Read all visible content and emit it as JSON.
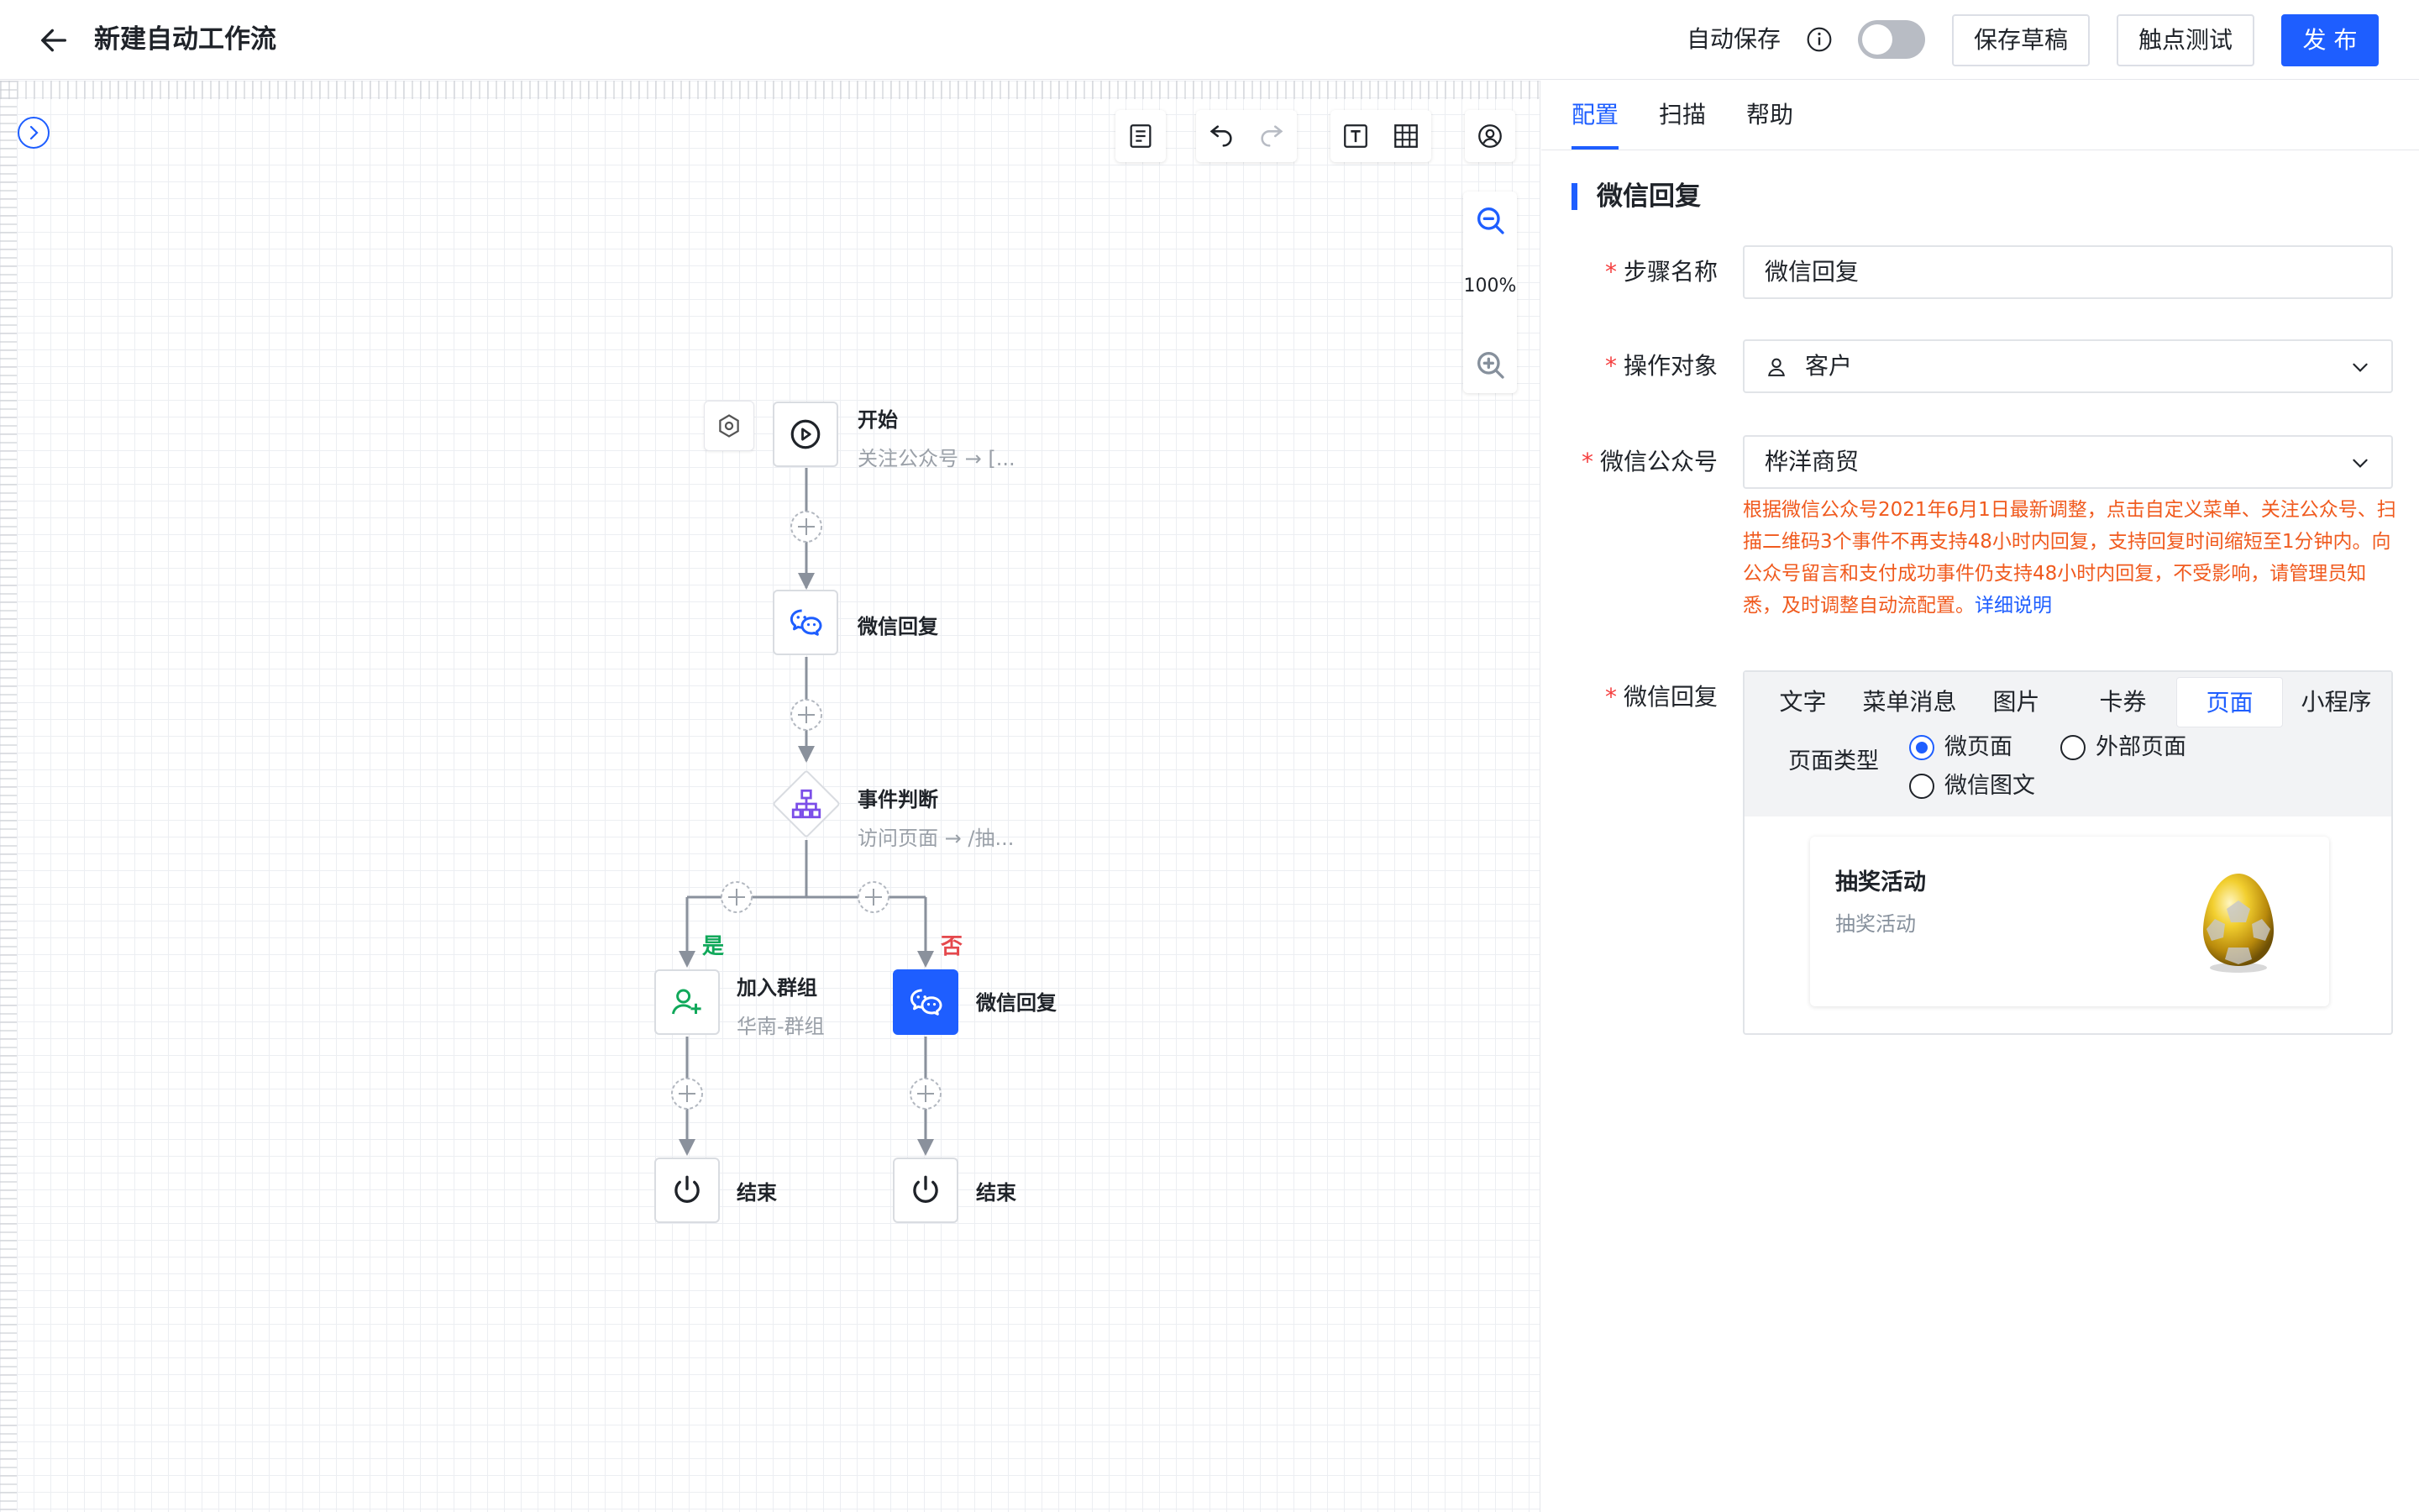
{
  "header": {
    "title": "新建自动工作流",
    "autosave_label": "自动保存",
    "autosave_on": false,
    "save_draft": "保存草稿",
    "touch_test": "触点测试",
    "publish": "发 布"
  },
  "toolbar": {
    "zoom_level": "100%"
  },
  "flow": {
    "start": {
      "title": "开始",
      "subtitle": "关注公众号 → [..."
    },
    "reply1": {
      "title": "微信回复"
    },
    "decision": {
      "title": "事件判断",
      "subtitle": "访问页面 → /抽..."
    },
    "branch_yes": "是",
    "branch_no": "否",
    "join_group": {
      "title": "加入群组",
      "subtitle": "华南-群组"
    },
    "reply2": {
      "title": "微信回复"
    },
    "end1": {
      "title": "结束"
    },
    "end2": {
      "title": "结束"
    }
  },
  "panel": {
    "tabs": [
      "配置",
      "扫描",
      "帮助"
    ],
    "section_title": "微信回复",
    "fields": {
      "step_name": {
        "label": "步骤名称",
        "value": "微信回复"
      },
      "target": {
        "label": "操作对象",
        "value": "客户"
      },
      "account": {
        "label": "微信公众号",
        "value": "桦洋商贸"
      },
      "reply": {
        "label": "微信回复"
      }
    },
    "warning": "根据微信公众号2021年6月1日最新调整，点击自定义菜单、关注公众号、扫描二维码3个事件不再支持48小时内回复，支持回复时间缩短至1分钟内。向公众号留言和支付成功事件仍支持48小时内回复，不受影响，请管理员知悉，及时调整自动流配置。",
    "warning_link": "详细说明",
    "reply_tabs": [
      "文字",
      "菜单消息",
      "图片",
      "卡券",
      "页面",
      "小程序"
    ],
    "reply_tab_active": "页面",
    "page_type_label": "页面类型",
    "page_type_options": [
      "微页面",
      "外部页面",
      "微信图文"
    ],
    "page_type_selected": "微页面",
    "card": {
      "title": "抽奖活动",
      "subtitle": "抽奖活动"
    }
  },
  "colors": {
    "accent": "#1e5eff",
    "warning": "#f05a1e",
    "yes": "#10a85a",
    "no": "#e5484d"
  }
}
